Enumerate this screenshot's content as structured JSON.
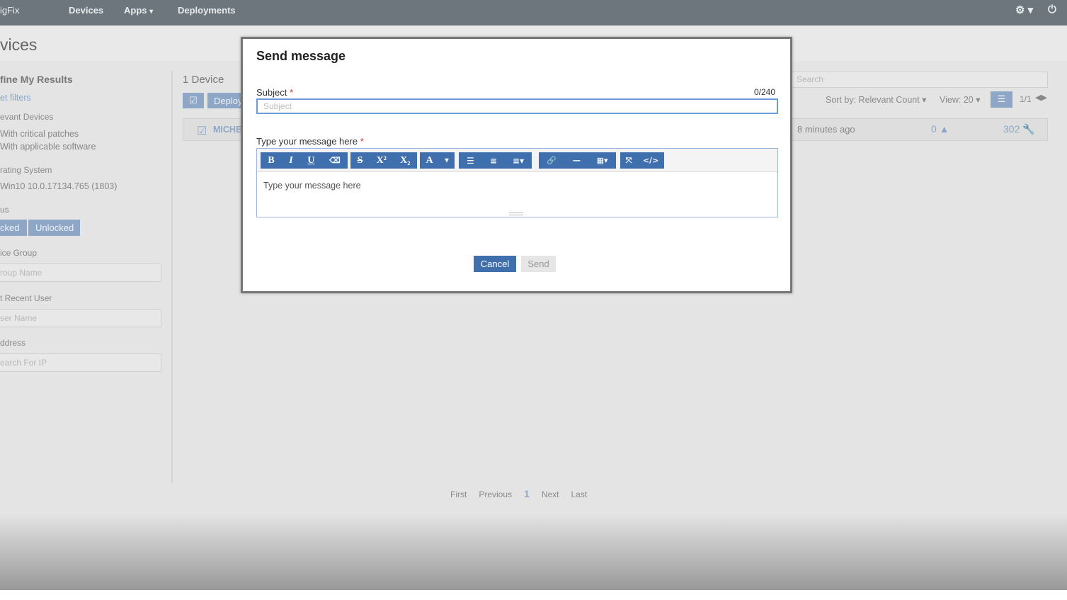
{
  "nav": {
    "brand": "igFix",
    "items": [
      "Devices",
      "Apps",
      "Deployments"
    ],
    "apps_caret": "▾",
    "settings": "⚙ ▾",
    "power": "⏻"
  },
  "page": {
    "title": "vices",
    "device_count": "1 Device",
    "deploy_label": "Deploy",
    "device_name": "MICHE",
    "last_seen": "8 minutes ago",
    "alerts": "0",
    "patches": "302",
    "search_placeholder": "Search",
    "sort": "Sort by: Relevant Count ▾",
    "view": "View: 20 ▾",
    "pager": "1/1"
  },
  "sidebar": {
    "heading": "fine My Results",
    "reset": "et filters",
    "relevant_label": "evant Devices",
    "relevant_items": [
      "With critical patches",
      "With applicable software"
    ],
    "os_label": "rating System",
    "os_value": "Win10 10.0.17134.765 (1803)",
    "status_label": "us",
    "status_locked": "cked",
    "status_unlocked": "Unlocked",
    "group_label": "ice Group",
    "group_placeholder": "roup Name",
    "user_label": "t Recent User",
    "user_placeholder": "ser Name",
    "ip_label": "ddress",
    "ip_placeholder": "earch For IP"
  },
  "pagination": {
    "first": "First",
    "previous": "Previous",
    "current": "1",
    "next": "Next",
    "last": "Last"
  },
  "modal": {
    "title": "Send message",
    "subject_label": "Subject",
    "required": "*",
    "counter": "0/240",
    "subject_placeholder": "Subject",
    "message_label": "Type your message here",
    "message_placeholder": "Type your message here",
    "toolbar": [
      [
        "B",
        "I",
        "U",
        "⌫"
      ],
      [
        "S",
        "X²",
        "X₂"
      ],
      [
        "A",
        "▾"
      ],
      [
        "☰",
        "≡",
        "≡▾"
      ],
      [
        "🔗",
        "—",
        "▦▾"
      ],
      [
        "⤧",
        "</>"
      ]
    ],
    "cancel": "Cancel",
    "send": "Send"
  }
}
